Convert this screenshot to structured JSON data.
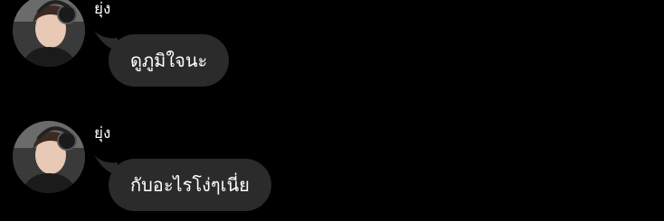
{
  "chat": {
    "messages": [
      {
        "sender": "ยุ่ง",
        "text": "ดูภูมิใจนะ",
        "avatar_icon": "user-avatar-headphones"
      },
      {
        "sender": "ยุ่ง",
        "text": "กับอะไรโง่ๆเนี่ย",
        "avatar_icon": "user-avatar-headphones"
      }
    ]
  },
  "colors": {
    "background": "#000000",
    "bubble": "#2b2b2b",
    "text": "#ffffff"
  }
}
